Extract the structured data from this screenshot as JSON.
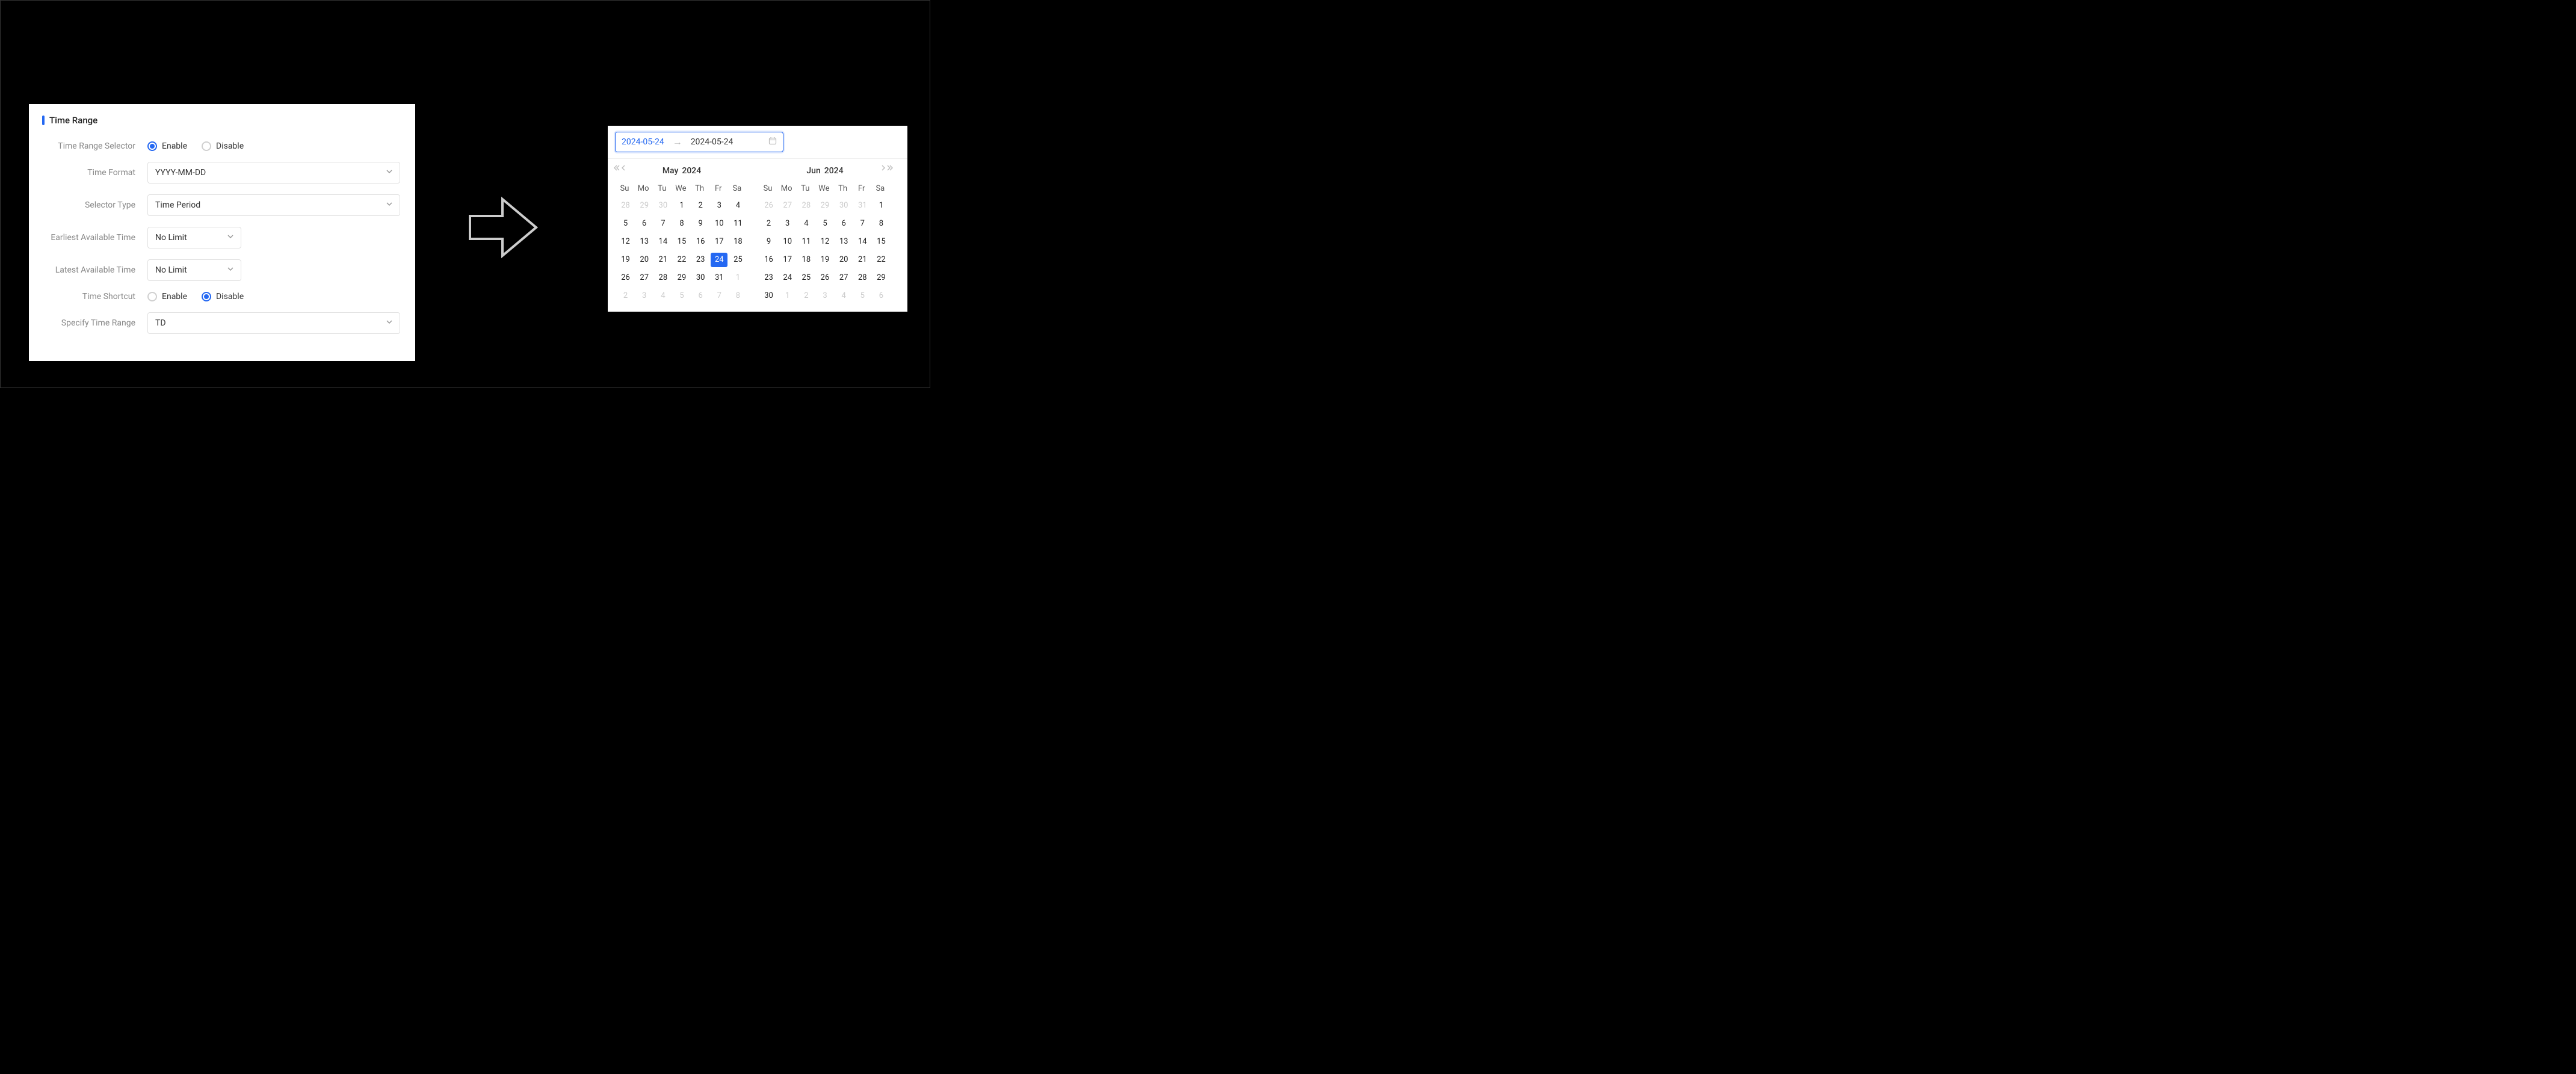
{
  "settings": {
    "title": "Time Range",
    "rows": {
      "selector_label": "Time Range Selector",
      "selector_enable": "Enable",
      "selector_disable": "Disable",
      "format_label": "Time Format",
      "format_value": "YYYY-MM-DD",
      "type_label": "Selector Type",
      "type_value": "Time Period",
      "earliest_label": "Earliest Available Time",
      "earliest_value": "No Limit",
      "latest_label": "Latest Available Time",
      "latest_value": "No Limit",
      "shortcut_label": "Time Shortcut",
      "shortcut_enable": "Enable",
      "shortcut_disable": "Disable",
      "specify_label": "Specify Time Range",
      "specify_value": "TD"
    }
  },
  "date_picker": {
    "start": "2024-05-24",
    "end": "2024-05-24",
    "left": {
      "month_label": "May",
      "year_label": "2024",
      "weekdays": [
        "Su",
        "Mo",
        "Tu",
        "We",
        "Th",
        "Fr",
        "Sa"
      ],
      "days": [
        {
          "n": "28",
          "muted": true
        },
        {
          "n": "29",
          "muted": true
        },
        {
          "n": "30",
          "muted": true
        },
        {
          "n": "1"
        },
        {
          "n": "2"
        },
        {
          "n": "3"
        },
        {
          "n": "4"
        },
        {
          "n": "5"
        },
        {
          "n": "6"
        },
        {
          "n": "7"
        },
        {
          "n": "8"
        },
        {
          "n": "9"
        },
        {
          "n": "10"
        },
        {
          "n": "11"
        },
        {
          "n": "12"
        },
        {
          "n": "13"
        },
        {
          "n": "14"
        },
        {
          "n": "15"
        },
        {
          "n": "16"
        },
        {
          "n": "17"
        },
        {
          "n": "18"
        },
        {
          "n": "19"
        },
        {
          "n": "20"
        },
        {
          "n": "21"
        },
        {
          "n": "22"
        },
        {
          "n": "23"
        },
        {
          "n": "24",
          "selected": true
        },
        {
          "n": "25"
        },
        {
          "n": "26"
        },
        {
          "n": "27"
        },
        {
          "n": "28"
        },
        {
          "n": "29"
        },
        {
          "n": "30"
        },
        {
          "n": "31"
        },
        {
          "n": "1",
          "muted": true
        },
        {
          "n": "2",
          "muted": true
        },
        {
          "n": "3",
          "muted": true
        },
        {
          "n": "4",
          "muted": true
        },
        {
          "n": "5",
          "muted": true
        },
        {
          "n": "6",
          "muted": true
        },
        {
          "n": "7",
          "muted": true
        },
        {
          "n": "8",
          "muted": true
        }
      ]
    },
    "right": {
      "month_label": "Jun",
      "year_label": "2024",
      "weekdays": [
        "Su",
        "Mo",
        "Tu",
        "We",
        "Th",
        "Fr",
        "Sa"
      ],
      "days": [
        {
          "n": "26",
          "muted": true
        },
        {
          "n": "27",
          "muted": true
        },
        {
          "n": "28",
          "muted": true
        },
        {
          "n": "29",
          "muted": true
        },
        {
          "n": "30",
          "muted": true
        },
        {
          "n": "31",
          "muted": true
        },
        {
          "n": "1"
        },
        {
          "n": "2"
        },
        {
          "n": "3"
        },
        {
          "n": "4"
        },
        {
          "n": "5"
        },
        {
          "n": "6"
        },
        {
          "n": "7"
        },
        {
          "n": "8"
        },
        {
          "n": "9"
        },
        {
          "n": "10"
        },
        {
          "n": "11"
        },
        {
          "n": "12"
        },
        {
          "n": "13"
        },
        {
          "n": "14"
        },
        {
          "n": "15"
        },
        {
          "n": "16"
        },
        {
          "n": "17"
        },
        {
          "n": "18"
        },
        {
          "n": "19"
        },
        {
          "n": "20"
        },
        {
          "n": "21"
        },
        {
          "n": "22"
        },
        {
          "n": "23"
        },
        {
          "n": "24"
        },
        {
          "n": "25"
        },
        {
          "n": "26"
        },
        {
          "n": "27"
        },
        {
          "n": "28"
        },
        {
          "n": "29"
        },
        {
          "n": "30"
        },
        {
          "n": "1",
          "muted": true
        },
        {
          "n": "2",
          "muted": true
        },
        {
          "n": "3",
          "muted": true
        },
        {
          "n": "4",
          "muted": true
        },
        {
          "n": "5",
          "muted": true
        },
        {
          "n": "6",
          "muted": true
        }
      ]
    }
  }
}
